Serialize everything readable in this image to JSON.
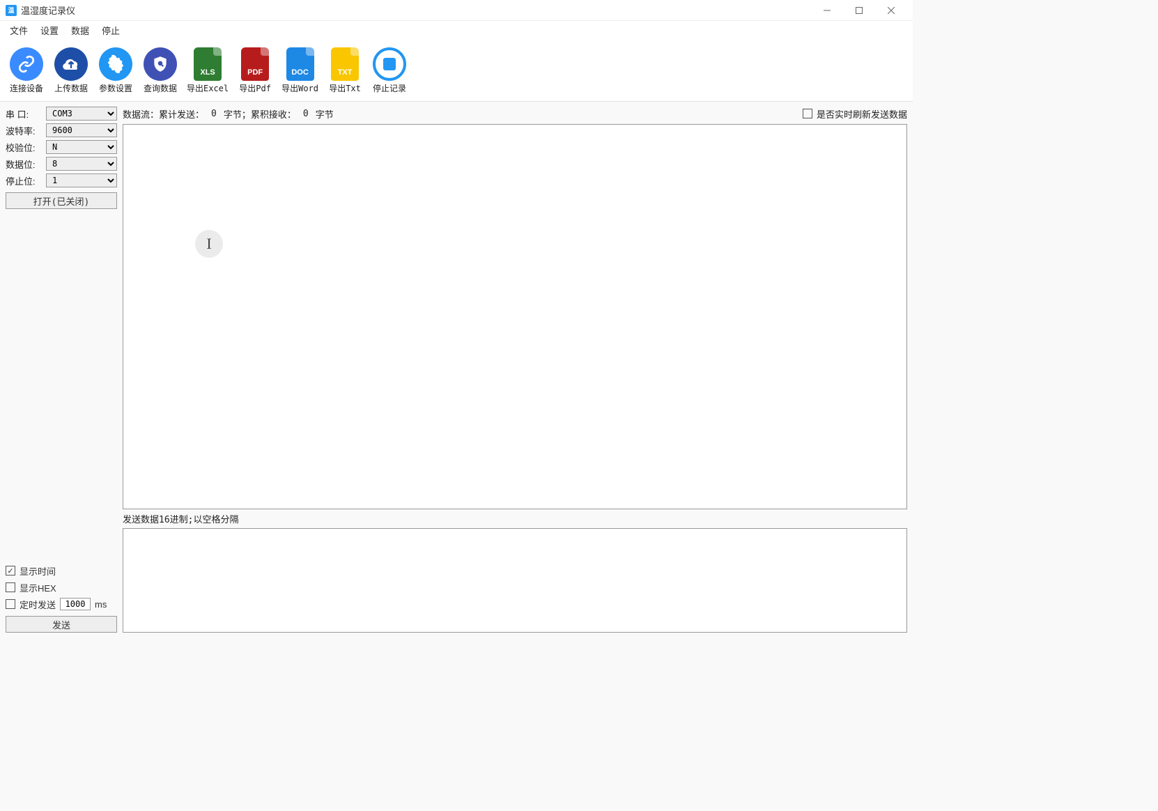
{
  "title": "温湿度记录仪",
  "menu": {
    "file": "文件",
    "settings": "设置",
    "data": "数据",
    "stop": "停止"
  },
  "toolbar": {
    "connect": "连接设备",
    "upload": "上传数据",
    "params": "参数设置",
    "query": "查询数据",
    "xls": "导出Excel",
    "pdf": "导出Pdf",
    "doc": "导出Word",
    "txt": "导出Txt",
    "stoprec": "停止记录",
    "xls_tag": "XLS",
    "pdf_tag": "PDF",
    "doc_tag": "DOC",
    "txt_tag": "TXT"
  },
  "serial": {
    "port_label": "串  口:",
    "baud_label": "波特率:",
    "check_label": "校验位:",
    "databit_label": "数据位:",
    "stopbit_label": "停止位:",
    "port": "COM3",
    "baud": "9600",
    "check": "N",
    "databit": "8",
    "stopbit": "1",
    "open_btn": "打开(已关闭)"
  },
  "options": {
    "show_time": "显示时间",
    "show_hex": "显示HEX",
    "timed_send": "定时发送",
    "interval": "1000",
    "unit": "ms",
    "send_btn": "发送"
  },
  "info": {
    "flow_label": "数据流：",
    "sent_label": "累计发送：",
    "sent": "0",
    "byte1": "字节；",
    "recv_label": "累积接收：",
    "recv": "0",
    "byte2": "字节",
    "realtime_cb": "是否实时刷新发送数据"
  },
  "send_area_label": "发送数据16进制;以空格分隔"
}
